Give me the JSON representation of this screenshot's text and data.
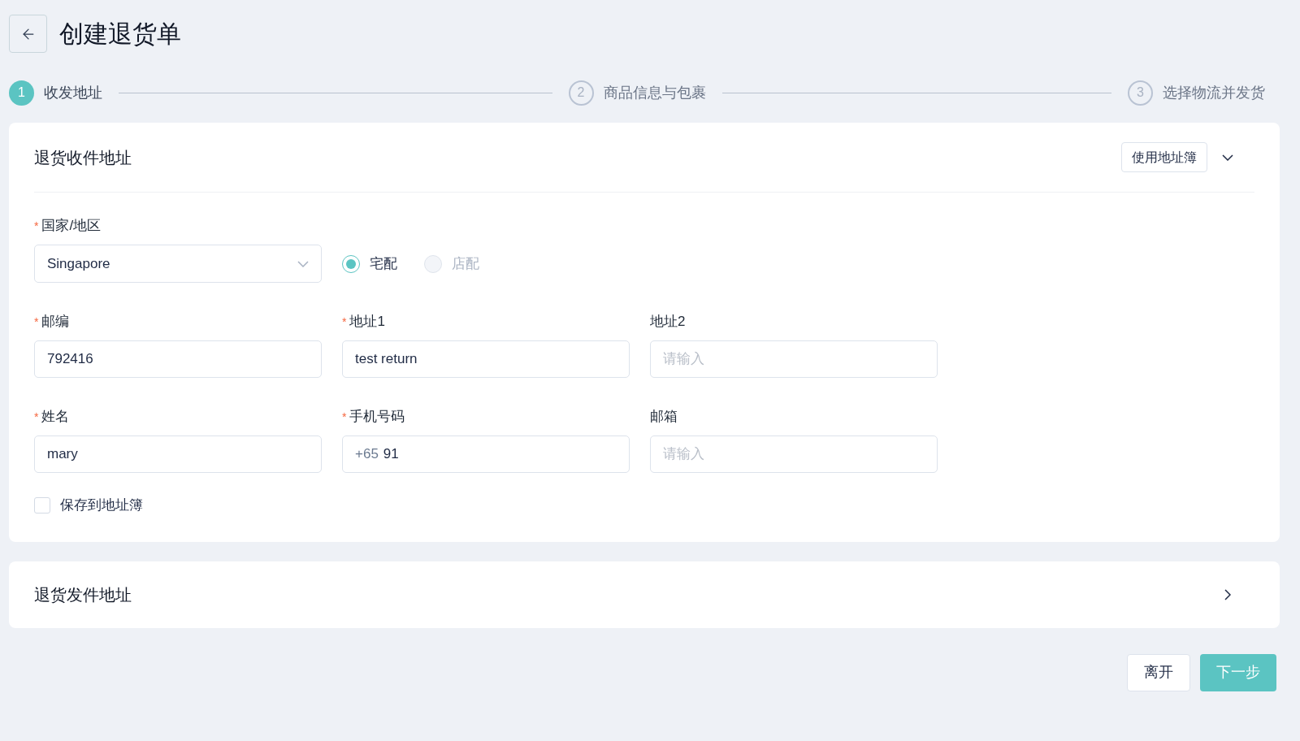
{
  "header": {
    "title": "创建退货单"
  },
  "steps": [
    {
      "number": "1",
      "label": "收发地址",
      "selected": true
    },
    {
      "number": "2",
      "label": "商品信息与包裹",
      "selected": false
    },
    {
      "number": "3",
      "label": "选择物流并发货",
      "selected": false
    }
  ],
  "return_receiver_section": {
    "title": "退货收件地址",
    "expanded": true,
    "address_book_button": "使用地址簿",
    "country": {
      "label": "国家/地区",
      "required_mark": "*",
      "value": "Singapore"
    },
    "delivery_options": [
      {
        "label": "宅配",
        "selected": true,
        "disabled": false
      },
      {
        "label": "店配",
        "selected": false,
        "disabled": true
      }
    ],
    "field_rows": [
      [
        {
          "label": "邮编",
          "required_mark": "*",
          "value": "792416"
        },
        {
          "label": "地址1",
          "required_mark": "*",
          "value": "test return"
        },
        {
          "label": "地址2",
          "placeholder": "请输入"
        }
      ],
      [
        {
          "label": "姓名",
          "required_mark": "*",
          "value": "mary"
        },
        {
          "label": "手机号码",
          "required_mark": "*",
          "prefix": "+65",
          "value": "91"
        },
        {
          "label": "邮箱",
          "placeholder": "请输入"
        }
      ]
    ],
    "save_checkbox": {
      "label": "保存到地址簿",
      "checked": false
    }
  },
  "return_sender_section": {
    "title": "退货发件地址",
    "expanded": false
  },
  "footer": {
    "buttons": [
      {
        "label": "离开",
        "kind": "secondary"
      },
      {
        "label": "下一步",
        "kind": "primary"
      }
    ]
  }
}
